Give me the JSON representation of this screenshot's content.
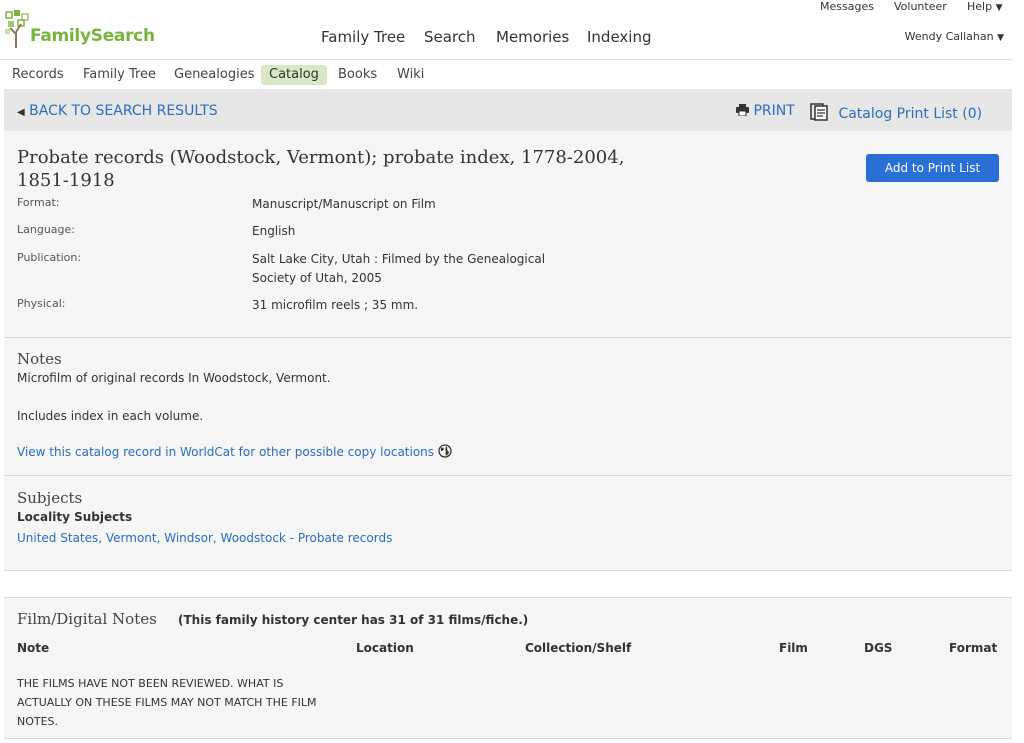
{
  "utility": {
    "messages": "Messages",
    "volunteer": "Volunteer",
    "help": "Help"
  },
  "logo": {
    "text": "FamilySearch"
  },
  "nav": {
    "family_tree": "Family Tree",
    "search": "Search",
    "memories": "Memories",
    "indexing": "Indexing"
  },
  "user": {
    "name": "Wendy Callahan"
  },
  "subnav": [
    "Records",
    "Family Tree",
    "Genealogies",
    "Catalog",
    "Books",
    "Wiki"
  ],
  "toolbar": {
    "back": "BACK TO SEARCH RESULTS",
    "print": "PRINT",
    "print_list": "Catalog Print List (0)"
  },
  "record": {
    "title": "Probate records (Woodstock, Vermont); probate index, 1778-2004, 1851-1918",
    "add_button": "Add to Print List",
    "fields": [
      {
        "label": "Format:",
        "value": "Manuscript/Manuscript on Film"
      },
      {
        "label": "Language:",
        "value": "English"
      },
      {
        "label": "Publication:",
        "value": "Salt Lake City, Utah : Filmed by the Genealogical Society of Utah, 2005"
      },
      {
        "label": "Physical:",
        "value": "31 microfilm reels ; 35 mm."
      }
    ]
  },
  "notes": {
    "heading": "Notes",
    "line1": "Microfilm of original records In Woodstock, Vermont.",
    "line2": "Includes index in each volume.",
    "worldcat_link": "View this catalog record in WorldCat for other possible copy locations"
  },
  "subjects": {
    "heading": "Subjects",
    "subheading": "Locality Subjects",
    "link": "United States, Vermont, Windsor, Woodstock - Probate records"
  },
  "film": {
    "heading": "Film/Digital Notes",
    "count": "(This family history center has 31 of 31 films/fiche.)",
    "columns": [
      "Note",
      "Location",
      "Collection/Shelf",
      "Film",
      "DGS",
      "Format"
    ],
    "row_note": "THE FILMS HAVE NOT BEEN REVIEWED. WHAT IS ACTUALLY ON THESE FILMS MAY NOT MATCH THE FILM NOTES."
  },
  "colors": {
    "link": "#2a6ebb",
    "button": "#2a6fd6",
    "logo_green": "#7ab33e",
    "active_tab": "#d8e8c6"
  }
}
